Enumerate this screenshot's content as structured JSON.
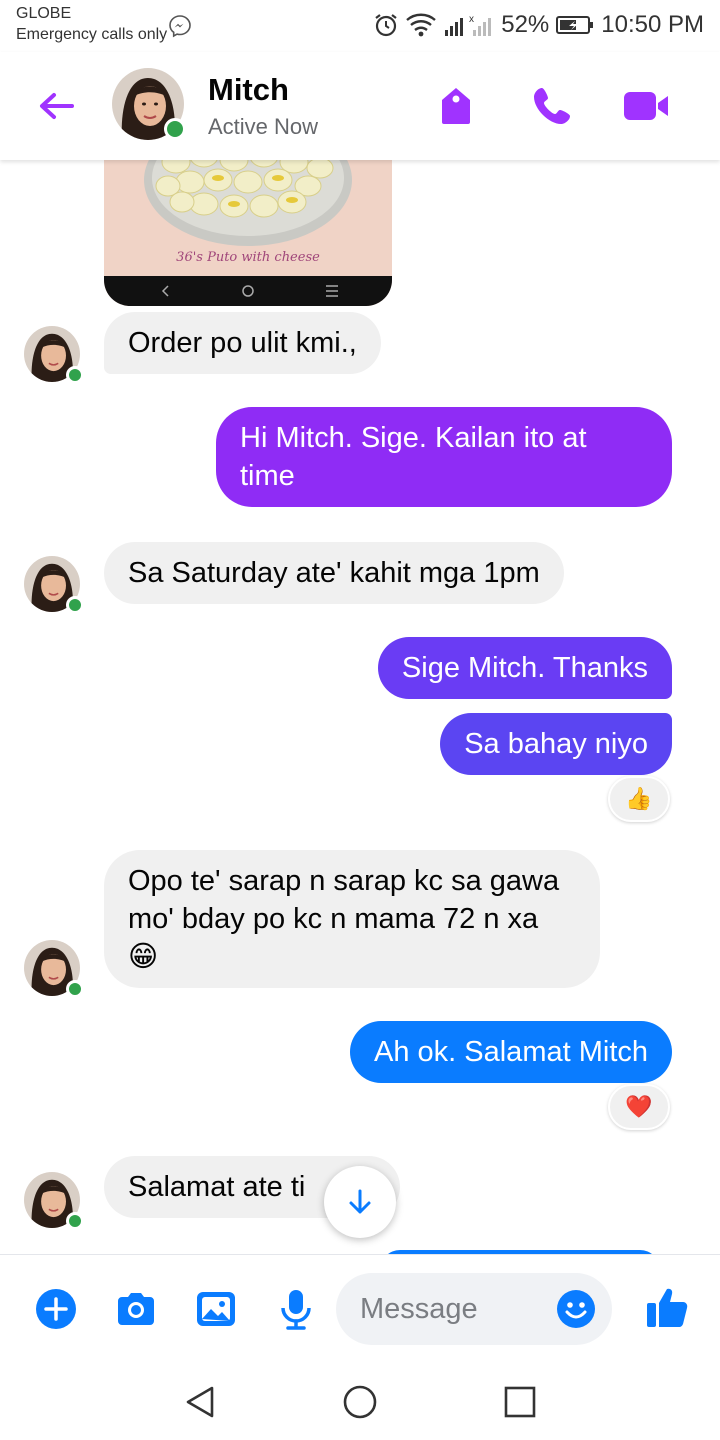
{
  "status_bar": {
    "carrier": "GLOBE",
    "emergency": "Emergency calls only",
    "battery": "52%",
    "time": "10:50 PM"
  },
  "header": {
    "contact_name": "Mitch",
    "presence": "Active Now"
  },
  "shared_image": {
    "caption": "36's Puto with cheese"
  },
  "messages": [
    {
      "from": "contact",
      "text": "Order po ulit kmi.,"
    },
    {
      "from": "me",
      "text": "Hi Mitch. Sige. Kailan ito at time"
    },
    {
      "from": "contact",
      "text": "Sa Saturday ate' kahit mga 1pm"
    },
    {
      "from": "me",
      "text": "Sige Mitch. Thanks"
    },
    {
      "from": "me",
      "text": "Sa bahay niyo",
      "reaction": "👍"
    },
    {
      "from": "contact",
      "text": "Opo te' sarap n sarap kc sa gawa mo' bday po kc n mama 72 n xa 😁"
    },
    {
      "from": "me",
      "text": "Ah ok. Salamat Mitch",
      "reaction": "❤️"
    },
    {
      "from": "contact",
      "text": "Salamat ate ti"
    }
  ],
  "composer": {
    "placeholder": "Message"
  },
  "colors": {
    "accent": "#a033ff",
    "bubble_purple": "#8f2cf5",
    "bubble_indigo": "#5b45f2",
    "bubble_blue": "#0a7cff",
    "incoming": "#f0f0f0",
    "online": "#31a24c"
  },
  "icons": [
    "back-arrow-icon",
    "tag-icon",
    "phone-icon",
    "video-camera-icon",
    "plus-icon",
    "camera-icon",
    "gallery-icon",
    "microphone-icon",
    "emoji-icon",
    "thumbs-up-icon",
    "arrow-down-icon"
  ]
}
